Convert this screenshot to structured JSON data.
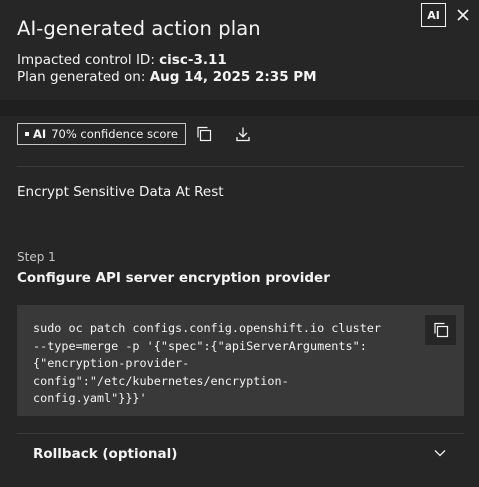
{
  "panel": {
    "title": "AI-generated action plan",
    "ai_tag": "AI",
    "control_label": "Impacted control ID:",
    "control_value": "cisc-3.11",
    "generated_label": "Plan generated on:",
    "generated_value": "Aug 14, 2025 2:35 PM"
  },
  "toolbar": {
    "badge_ai": "AI",
    "badge_text": "70% confidence score",
    "copy_icon": "copy-icon",
    "download_icon": "download-icon"
  },
  "plan": {
    "name": "Encrypt Sensitive Data At Rest",
    "steps": [
      {
        "label": "Step 1",
        "title": "Configure API server encryption provider",
        "code": "sudo oc patch configs.config.openshift.io cluster\n--type=merge -p '{\"spec\":{\"apiServerArguments\":\n{\"encryption-provider-\nconfig\":\"/etc/kubernetes/encryption-\nconfig.yaml\"}}}'"
      }
    ],
    "rollback_label": "Rollback (optional)"
  },
  "colors": {
    "background": "#262626",
    "code_background": "#393939",
    "text": "#f4f4f4"
  }
}
